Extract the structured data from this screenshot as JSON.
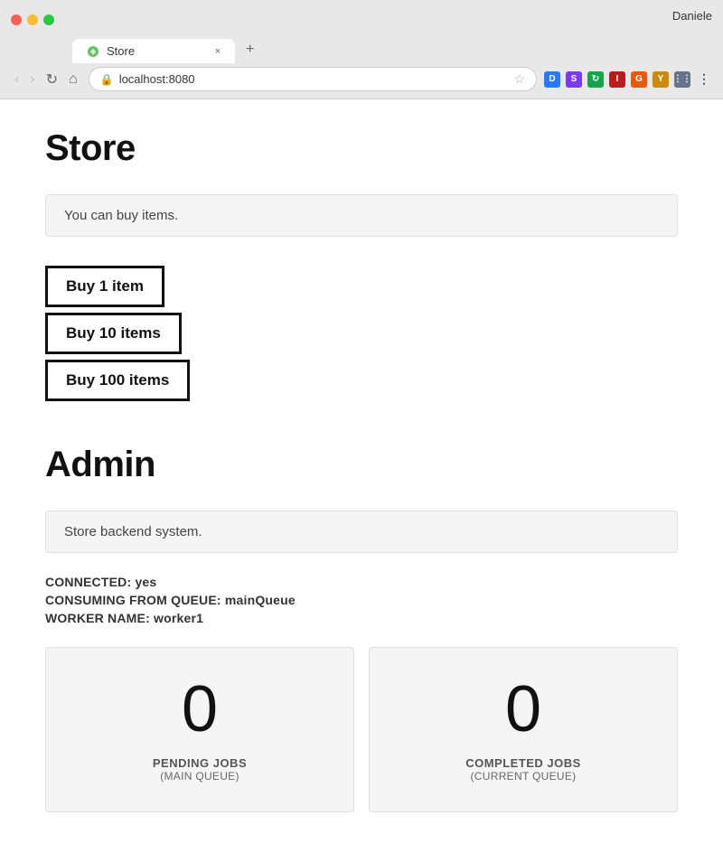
{
  "browser": {
    "tab_title": "Store",
    "url": "localhost:8080",
    "user_name": "Daniele",
    "tab_close_label": "×",
    "tab_new_label": "+",
    "nav_back": "‹",
    "nav_forward": "›",
    "nav_refresh": "↻",
    "nav_home": "⌂"
  },
  "store_section": {
    "title": "Store",
    "info_text": "You can buy items.",
    "buttons": [
      {
        "label": "Buy 1 item"
      },
      {
        "label": "Buy 10 items"
      },
      {
        "label": "Buy 100 items"
      }
    ]
  },
  "admin_section": {
    "title": "Admin",
    "info_text": "Store backend system.",
    "connected_label": "CONNECTED:",
    "connected_value": "yes",
    "queue_label": "CONSUMING FROM QUEUE:",
    "queue_value": "mainQueue",
    "worker_label": "WORKER NAME:",
    "worker_value": "worker1",
    "metrics": [
      {
        "number": "0",
        "label": "PENDING JOBS",
        "sublabel": "(MAIN QUEUE)"
      },
      {
        "number": "0",
        "label": "COMPLETED JOBS",
        "sublabel": "(CURRENT QUEUE)"
      }
    ]
  }
}
